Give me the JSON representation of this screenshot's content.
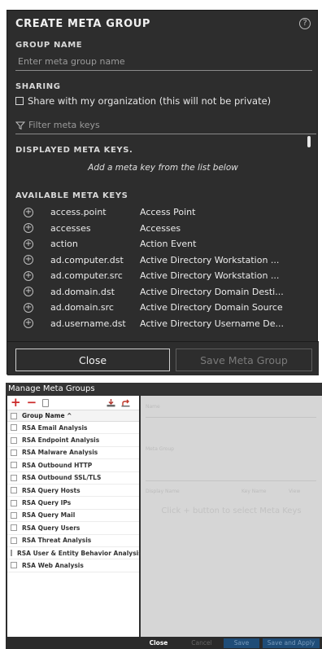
{
  "create_dialog": {
    "title": "CREATE META GROUP",
    "help_icon_text": "?",
    "group_name_label": "GROUP NAME",
    "group_name_placeholder": "Enter meta group name",
    "sharing_label": "SHARING",
    "share_checkbox_label": "Share with my organization (this will not be private)",
    "share_checked": false,
    "filter_placeholder": "Filter meta keys",
    "displayed_label": "DISPLAYED META KEYS.",
    "displayed_hint": "Add a meta key from the list below",
    "available_label": "AVAILABLE META KEYS",
    "available_keys": [
      {
        "key": "access.point",
        "desc": "Access Point"
      },
      {
        "key": "accesses",
        "desc": "Accesses"
      },
      {
        "key": "action",
        "desc": "Action Event"
      },
      {
        "key": "ad.computer.dst",
        "desc": "Active Directory Workstation ..."
      },
      {
        "key": "ad.computer.src",
        "desc": "Active Directory Workstation ..."
      },
      {
        "key": "ad.domain.dst",
        "desc": "Active Directory Domain Desti..."
      },
      {
        "key": "ad.domain.src",
        "desc": "Active Directory Domain Source"
      },
      {
        "key": "ad.username.dst",
        "desc": "Active Directory Username De..."
      }
    ],
    "close_label": "Close",
    "save_label": "Save Meta Group"
  },
  "manage_dialog": {
    "title": "Manage Meta Groups",
    "add_icon": "+",
    "remove_icon": "−",
    "column_header": "Group Name ^",
    "groups": [
      "RSA Email Analysis",
      "RSA Endpoint Analysis",
      "RSA Malware Analysis",
      "RSA Outbound HTTP",
      "RSA Outbound SSL/TLS",
      "RSA Query Hosts",
      "RSA Query IPs",
      "RSA Query Mail",
      "RSA Query Users",
      "RSA Threat Analysis",
      "RSA User & Entity Behavior Analysis",
      "RSA Web Analysis"
    ],
    "detail": {
      "name_label": "Name",
      "view_label": "Meta Group",
      "col_display": "Display Name",
      "col_key": "Key Name",
      "col_view": "View",
      "empty_message": "Click + button to select Meta Keys"
    },
    "buttons": {
      "close": "Close",
      "cancel": "Cancel",
      "save": "Save",
      "save_apply": "Save and Apply"
    }
  }
}
